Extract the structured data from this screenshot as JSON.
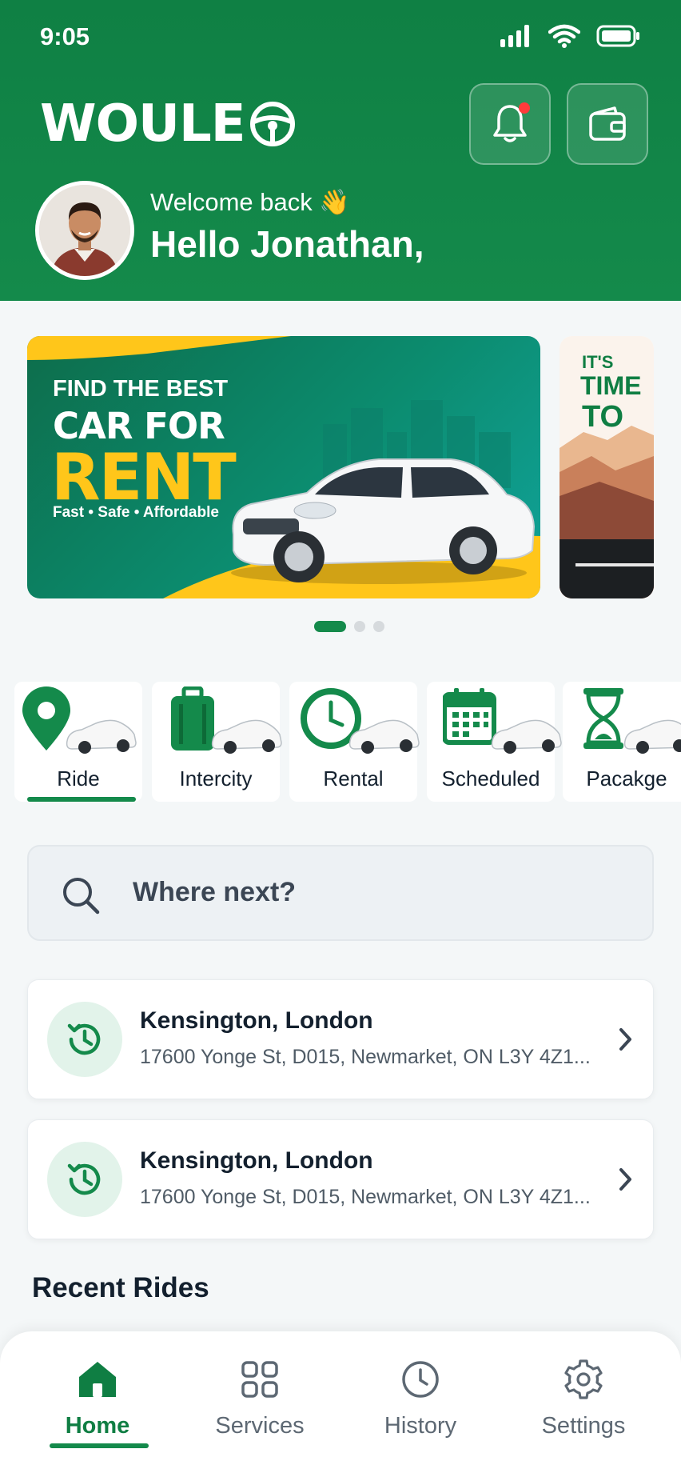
{
  "status": {
    "time": "9:05"
  },
  "brand": {
    "name": "WOULE"
  },
  "header": {
    "welcome": "Welcome back 👋",
    "greeting": "Hello Jonathan,"
  },
  "banner": {
    "line1": "FIND THE BEST",
    "line2": "CAR FOR",
    "line3": "RENT",
    "tagline": "Fast • Safe • Affordable",
    "side_line1": "IT'S",
    "side_line2": "TIME",
    "side_line3": "TO",
    "active_slide": 1,
    "slide_count": 3
  },
  "services": [
    {
      "label": "Ride",
      "icon": "location-pin-icon",
      "active": true
    },
    {
      "label": "Intercity",
      "icon": "suitcase-icon",
      "active": false
    },
    {
      "label": "Rental",
      "icon": "clock-icon",
      "active": false
    },
    {
      "label": "Scheduled",
      "icon": "calendar-icon",
      "active": false
    },
    {
      "label": "Pacakge",
      "icon": "hourglass-icon",
      "active": false
    }
  ],
  "search": {
    "placeholder": "Where next?"
  },
  "recent_places": [
    {
      "title": "Kensington, London",
      "address": "17600 Yonge St, D015, Newmarket, ON L3Y 4Z1..."
    },
    {
      "title": "Kensington, London",
      "address": "17600 Yonge St, D015, Newmarket, ON L3Y 4Z1..."
    }
  ],
  "sections": {
    "recent_rides": "Recent Rides"
  },
  "nav": [
    {
      "label": "Home",
      "icon": "home-icon",
      "active": true
    },
    {
      "label": "Services",
      "icon": "grid-icon",
      "active": false
    },
    {
      "label": "History",
      "icon": "clock-icon",
      "active": false
    },
    {
      "label": "Settings",
      "icon": "gear-icon",
      "active": false
    }
  ],
  "colors": {
    "primary": "#148a4b",
    "accent": "#ffc61a",
    "notification": "#ff3b3b"
  }
}
